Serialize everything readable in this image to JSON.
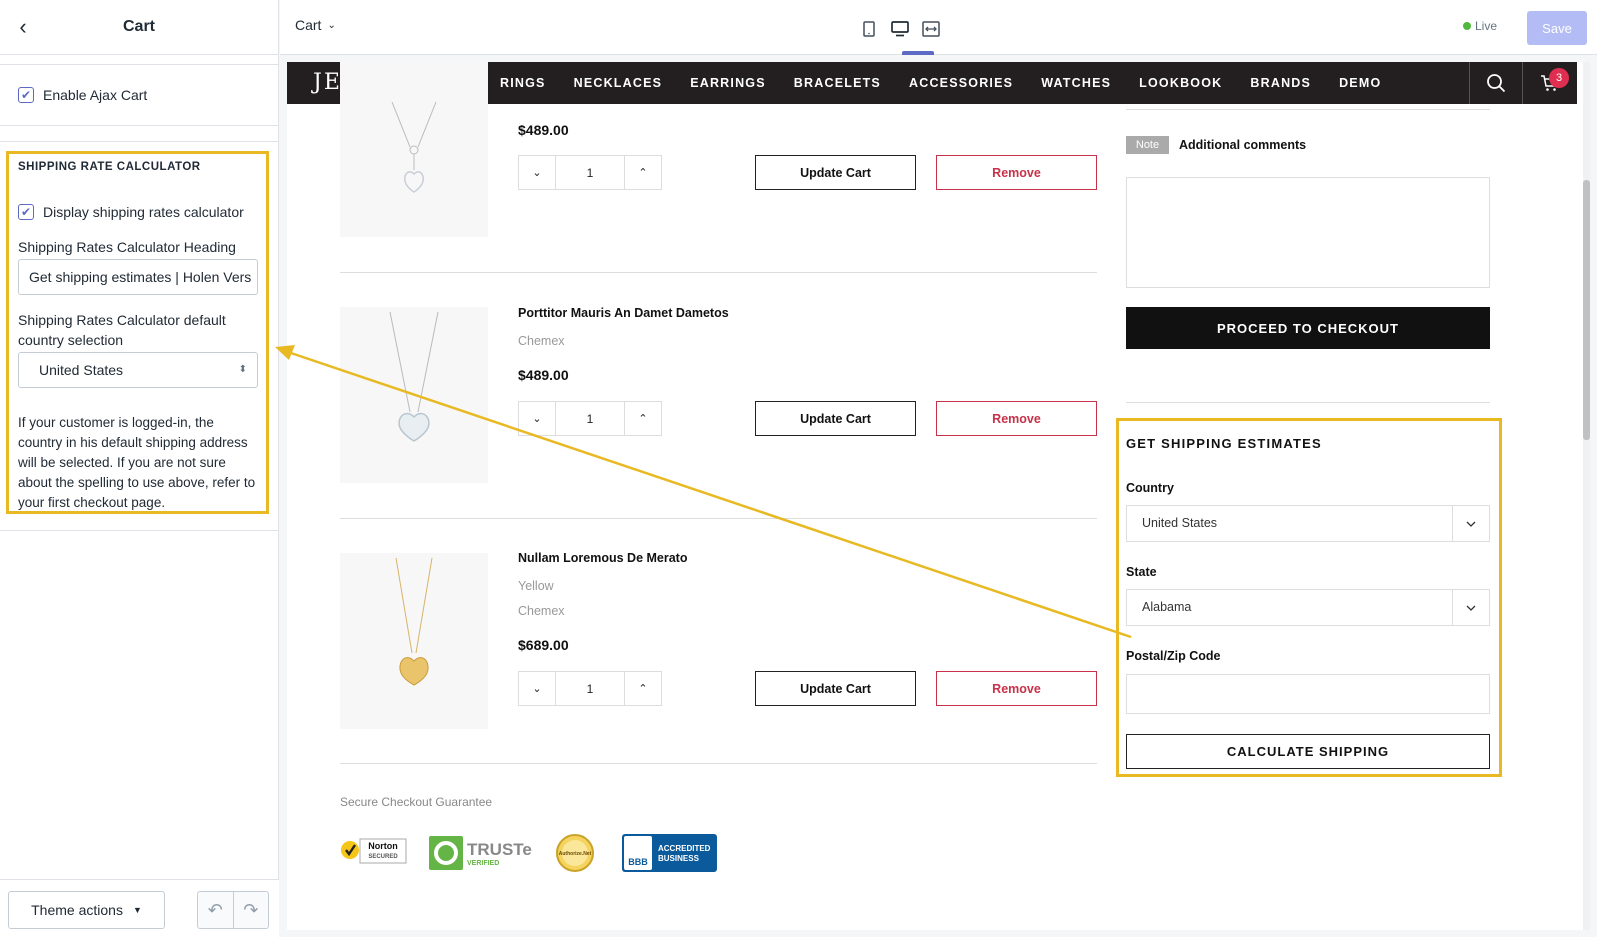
{
  "sidebar": {
    "title": "Cart",
    "enable_ajax_cart": {
      "label": "Enable Ajax Cart",
      "checked": true
    },
    "shipping_section": {
      "title": "SHIPPING RATE CALCULATOR",
      "display_calc": {
        "label": "Display shipping rates calculator",
        "checked": true
      },
      "heading_label": "Shipping Rates Calculator Heading",
      "heading_value": "Get shipping estimates | Holen Vers",
      "country_label": "Shipping Rates Calculator default country selection",
      "country_value": "United States",
      "help_text": "If your customer is logged-in, the country in his default shipping address will be selected. If you are not sure about the spelling to use above, refer to your first checkout page."
    },
    "theme_actions": "Theme actions"
  },
  "topbar": {
    "page_selector": "Cart",
    "live_label": "Live",
    "save_label": "Save"
  },
  "store": {
    "logo": "JEWELIAS",
    "nav": [
      "RINGS",
      "NECKLACES",
      "EARRINGS",
      "BRACELETS",
      "ACCESSORIES",
      "WATCHES",
      "LOOKBOOK",
      "BRANDS",
      "DEMO"
    ],
    "cart_count": "3",
    "update_label": "Update Cart",
    "remove_label": "Remove",
    "products": [
      {
        "name": "",
        "variant": "",
        "vendor": "",
        "price": "$489.00",
        "qty": "1"
      },
      {
        "name": "Porttitor Mauris An Damet Dametos",
        "variant": "",
        "vendor": "Chemex",
        "price": "$489.00",
        "qty": "1"
      },
      {
        "name": "Nullam Loremous De Merato",
        "variant": "Yellow",
        "vendor": "Chemex",
        "price": "$689.00",
        "qty": "1"
      }
    ],
    "secure_label": "Secure Checkout Guarantee",
    "badges": {
      "norton": "Norton",
      "norton_sub": "SECURED",
      "truste": "TRUSTe",
      "truste_sub": "VERIFIED",
      "authorize": "Authorize.Net",
      "bbb": "ACCREDITED BUSINESS",
      "bbb_short": "BBB"
    },
    "note_tag": "Note",
    "note_title": "Additional comments",
    "checkout_label": "PROCEED TO CHECKOUT",
    "shipping": {
      "title": "GET SHIPPING ESTIMATES",
      "country_label": "Country",
      "country_value": "United States",
      "state_label": "State",
      "state_value": "Alabama",
      "zip_label": "Postal/Zip Code",
      "calc_label": "CALCULATE SHIPPING"
    }
  },
  "colors": {
    "highlight": "#e8b923",
    "accent": "#5c6ac4",
    "remove": "#c7324a",
    "nav_bg": "#231f20"
  }
}
